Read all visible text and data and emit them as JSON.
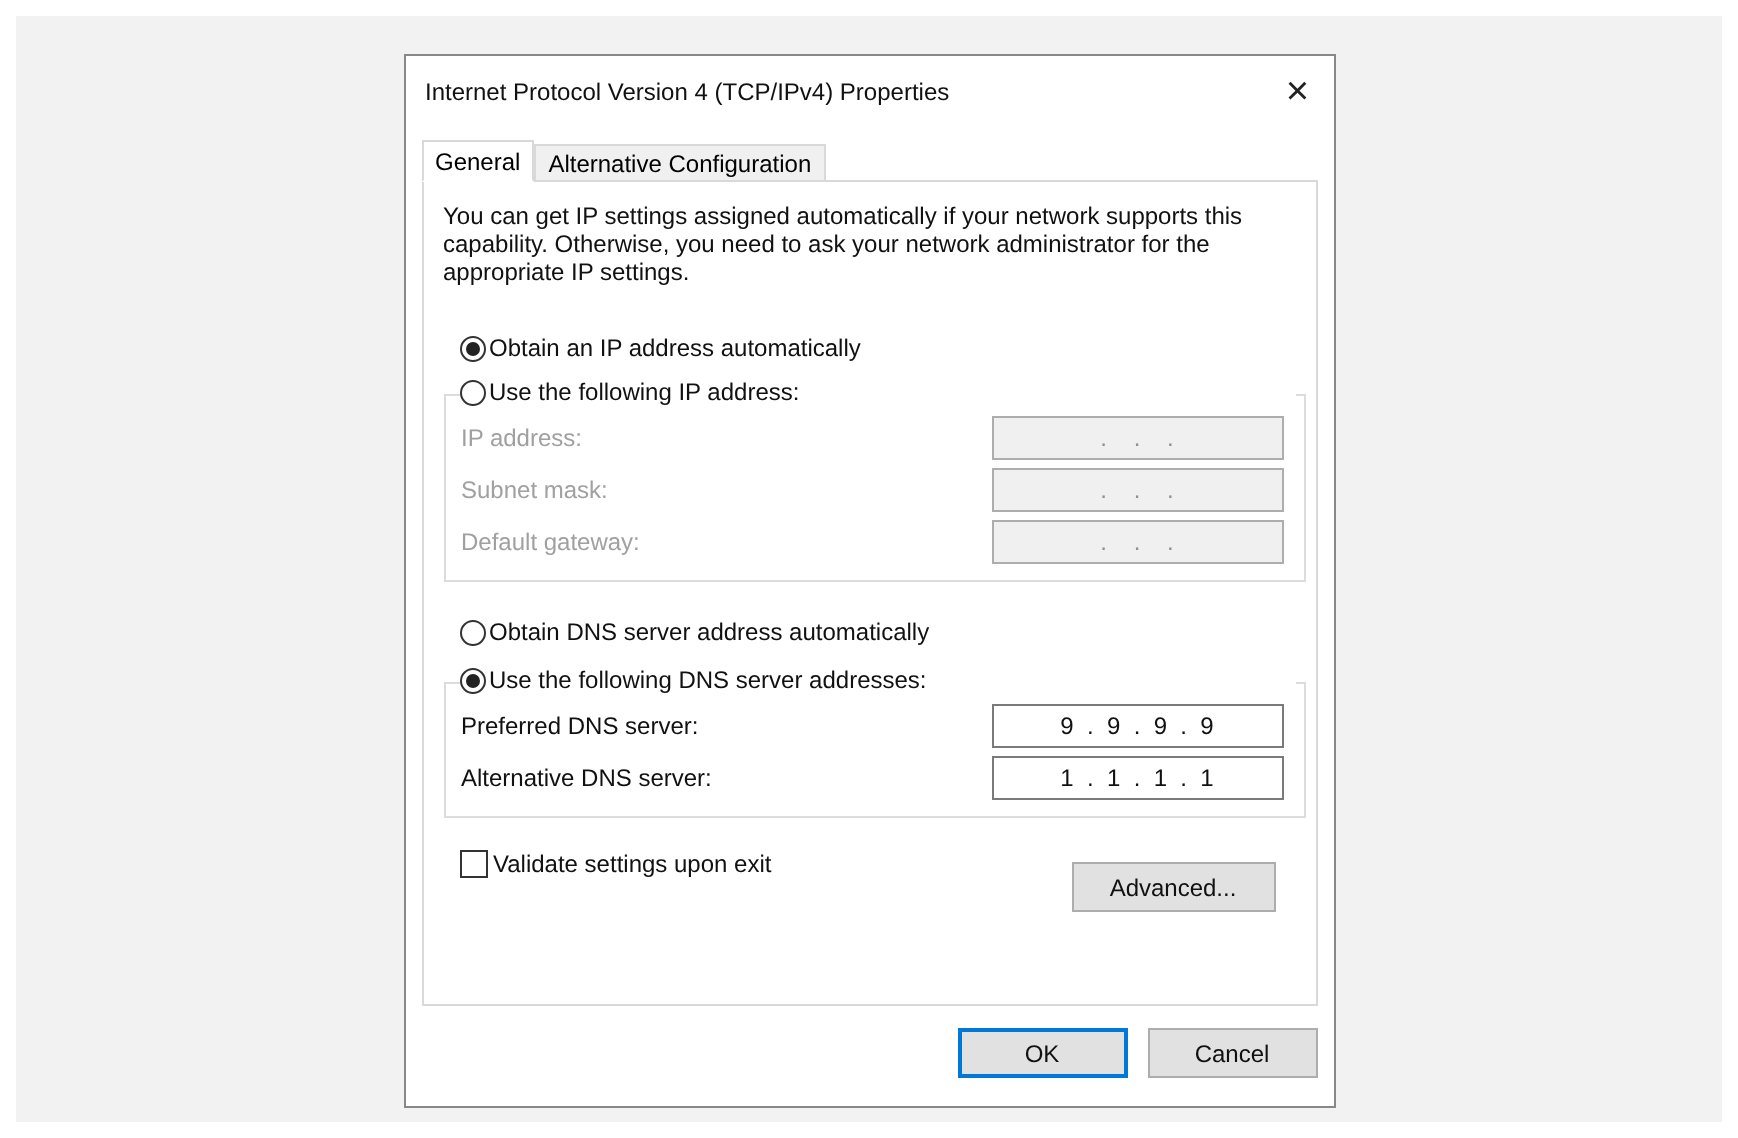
{
  "window": {
    "title": "Internet Protocol Version 4 (TCP/IPv4) Properties",
    "close": "×"
  },
  "tabs": [
    {
      "label": "General",
      "selected": true
    },
    {
      "label": "Alternative Configuration",
      "selected": false
    }
  ],
  "description": "You can get IP settings assigned automatically if your network supports this capability. Otherwise, you need to ask your network administrator for the appropriate IP settings.",
  "ip_mode": [
    {
      "label": "Obtain an IP address automatically",
      "selected": true
    },
    {
      "label": "Use the following IP address:",
      "selected": false
    }
  ],
  "ip_fields": [
    {
      "label": "IP address:",
      "value": ".    .    .",
      "disabled": true
    },
    {
      "label": "Subnet mask:",
      "value": ".    .    .",
      "disabled": true
    },
    {
      "label": "Default gateway:",
      "value": ".    .    .",
      "disabled": true
    }
  ],
  "dns_mode": [
    {
      "label": "Obtain DNS server address automatically",
      "selected": false
    },
    {
      "label": "Use the following DNS server addresses:",
      "selected": true
    }
  ],
  "dns_fields": [
    {
      "label": "Preferred DNS server:",
      "value": "9  .  9  .  9  .  9",
      "disabled": false
    },
    {
      "label": "Alternative DNS server:",
      "value": "1  .  1  .  1  .  1",
      "disabled": false
    }
  ],
  "validate": {
    "label": "Validate settings upon exit",
    "checked": false
  },
  "advanced_button": "Advanced...",
  "buttons": [
    {
      "label": "OK",
      "default": true
    },
    {
      "label": "Cancel",
      "default": false
    }
  ]
}
